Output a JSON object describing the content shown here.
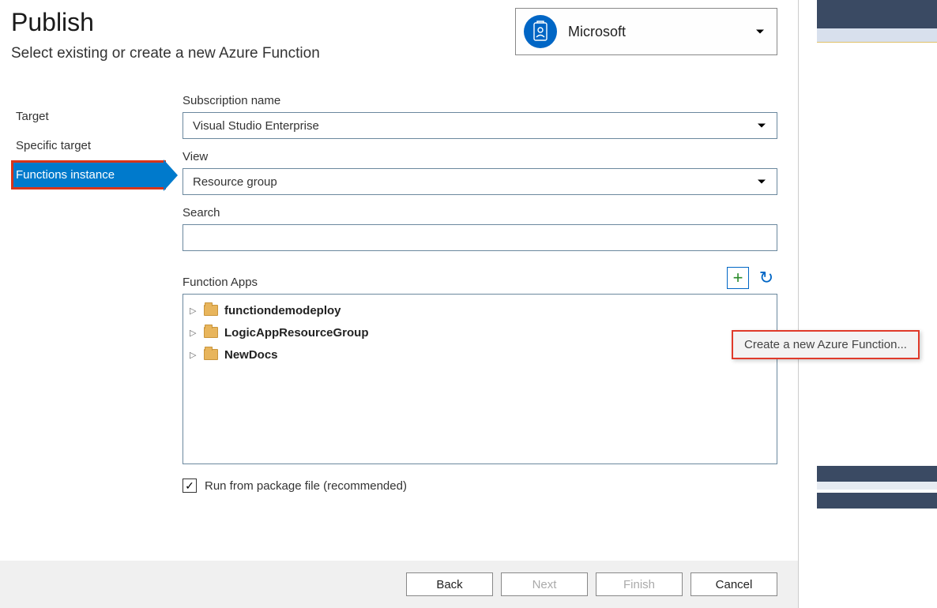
{
  "header": {
    "title": "Publish",
    "subtitle": "Select existing or create a new Azure Function"
  },
  "account": {
    "name": "Microsoft"
  },
  "steps": {
    "items": [
      {
        "label": "Target"
      },
      {
        "label": "Specific target"
      },
      {
        "label": "Functions instance"
      }
    ],
    "active_index": 2
  },
  "form": {
    "subscription": {
      "label": "Subscription name",
      "value": "Visual Studio Enterprise"
    },
    "view": {
      "label": "View",
      "value": "Resource group"
    },
    "search": {
      "label": "Search",
      "value": ""
    },
    "function_apps": {
      "label": "Function Apps",
      "items": [
        {
          "name": "functiondemodeploy"
        },
        {
          "name": "LogicAppResourceGroup"
        },
        {
          "name": "NewDocs"
        }
      ]
    },
    "run_from_package": {
      "label": "Run from package file (recommended)",
      "checked": true
    }
  },
  "footer": {
    "back": "Back",
    "next": "Next",
    "finish": "Finish",
    "cancel": "Cancel"
  },
  "tooltip": {
    "text": "Create a new Azure Function..."
  }
}
